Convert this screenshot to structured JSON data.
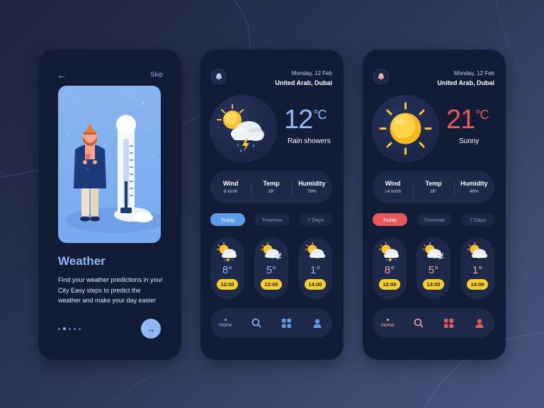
{
  "onboarding": {
    "back_icon": "arrow-left-icon",
    "skip_label": "Skip",
    "title": "Weather",
    "description": "Find your weather predictions in your City Easy steps to predict the weather and make your day easier",
    "page_dots": {
      "count": 5,
      "active": 1
    },
    "next_icon": "arrow-right-icon"
  },
  "screens": [
    {
      "accent": "#8fb8f6",
      "date": "Monday, 12 Feb",
      "location": "United Arab, Dubai",
      "main_icon": "rain-shower-icon",
      "temperature": "12",
      "temp_unit": "°C",
      "temp_color": "#8fb8f6",
      "condition": "Rain showers",
      "stats": [
        {
          "label": "Wind",
          "value": "8 km/h"
        },
        {
          "label": "Temp",
          "value": "18°"
        },
        {
          "label": "Humidity",
          "value": "79%"
        }
      ],
      "tabs": [
        {
          "label": "Today",
          "active": true
        },
        {
          "label": "Tmorrow",
          "active": false
        },
        {
          "label": "7 Days",
          "active": false
        }
      ],
      "hours": [
        {
          "icon": "sun-rain-cloud-icon",
          "temp": "8°",
          "time": "12:00"
        },
        {
          "icon": "sun-wind-cloud-icon",
          "temp": "5°",
          "time": "13:00"
        },
        {
          "icon": "sun-cloud-icon",
          "temp": "1°",
          "time": "14:00"
        }
      ],
      "nav": [
        {
          "label": "Home"
        },
        {
          "icon": "search-icon"
        },
        {
          "icon": "grid-icon"
        },
        {
          "icon": "user-icon"
        }
      ]
    },
    {
      "accent": "#e8585b",
      "date": "Monday, 12 Feb",
      "location": "United Arab, Dubai",
      "main_icon": "sun-icon",
      "temperature": "21",
      "temp_unit": "°C",
      "temp_color": "#e8585b",
      "condition": "Sunny",
      "stats": [
        {
          "label": "Wind",
          "value": "14 km/h"
        },
        {
          "label": "Temp",
          "value": "28°"
        },
        {
          "label": "Humidity",
          "value": "49%"
        }
      ],
      "tabs": [
        {
          "label": "Today",
          "active": true
        },
        {
          "label": "Tmorrow",
          "active": false
        },
        {
          "label": "7 Days",
          "active": false
        }
      ],
      "hours": [
        {
          "icon": "sun-rain-cloud-icon",
          "temp": "8°",
          "time": "12:00"
        },
        {
          "icon": "sun-wind-cloud-icon",
          "temp": "5°",
          "time": "13:00"
        },
        {
          "icon": "sun-cloud-icon",
          "temp": "1°",
          "time": "14:00"
        }
      ],
      "nav": [
        {
          "label": "Home"
        },
        {
          "icon": "search-icon"
        },
        {
          "icon": "grid-icon"
        },
        {
          "icon": "user-icon"
        }
      ]
    }
  ]
}
